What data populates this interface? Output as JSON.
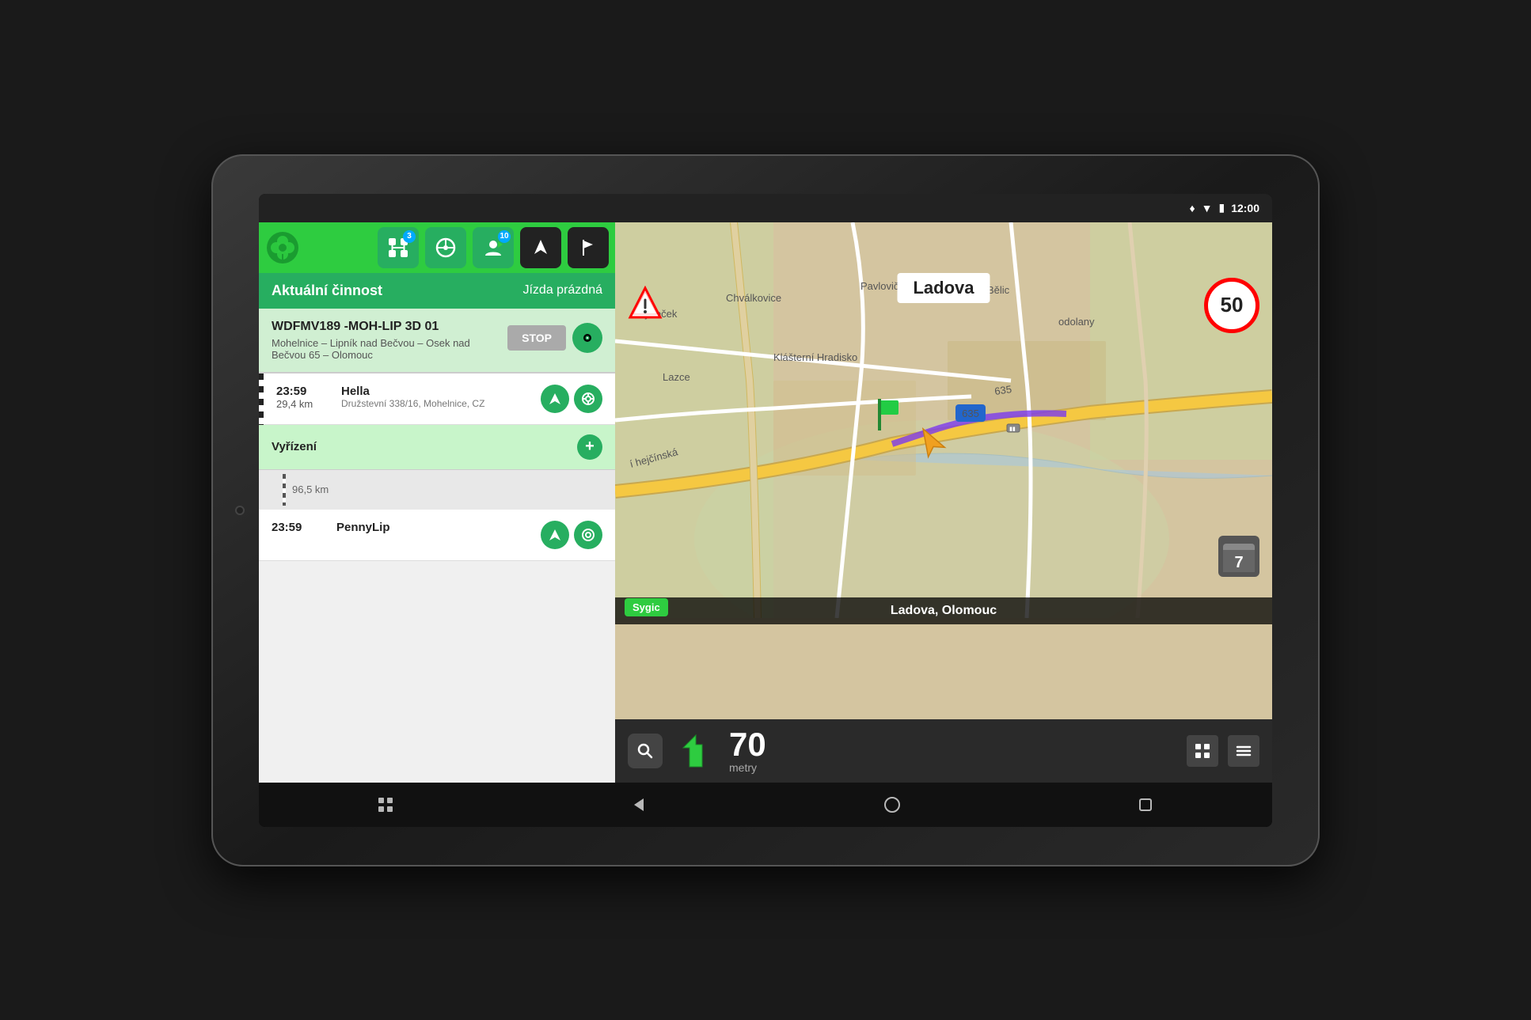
{
  "device": {
    "status_bar": {
      "time": "12:00",
      "icons": [
        "location",
        "wifi",
        "battery"
      ]
    }
  },
  "app": {
    "logo_symbol": "🍀",
    "header": {
      "nav_btn1_label": "⛓",
      "nav_btn1_badge": "3",
      "nav_btn2_label": "🎮",
      "nav_btn3_label": "👤",
      "nav_btn3_badge": "10",
      "nav_btn4_label": "➤",
      "nav_btn5_label": "⚑"
    },
    "activity_bar": {
      "label": "Aktuální činnost",
      "status": "Jízda prázdná"
    },
    "main_route": {
      "title": "WDFMV189 -MOH-LIP 3D 01",
      "subtitle": "Mohelnice – Lipník nad Bečvou – Osek nad Bečvou 65 – Olomouc",
      "stop_btn": "STOP"
    },
    "stop1": {
      "time": "23:59",
      "distance": "29,4 km",
      "name": "Hella",
      "address": "Družstevní 338/16, Mohelnice, CZ"
    },
    "resolution": {
      "label": "Vyřízení"
    },
    "separator_km": "96,5 km",
    "stop2": {
      "time": "23:59",
      "name": "PennyLip"
    }
  },
  "map": {
    "street_name": "Ladova",
    "speed_limit": "50",
    "location_text": "Ladova, Olomouc",
    "road_sign_635": "635",
    "sygic_logo": "Sygic",
    "distance_number": "70",
    "distance_unit": "metry",
    "calendar_day": "7"
  },
  "android_nav": {
    "back": "◁",
    "home": "○",
    "recent": "□",
    "apps": "□"
  }
}
